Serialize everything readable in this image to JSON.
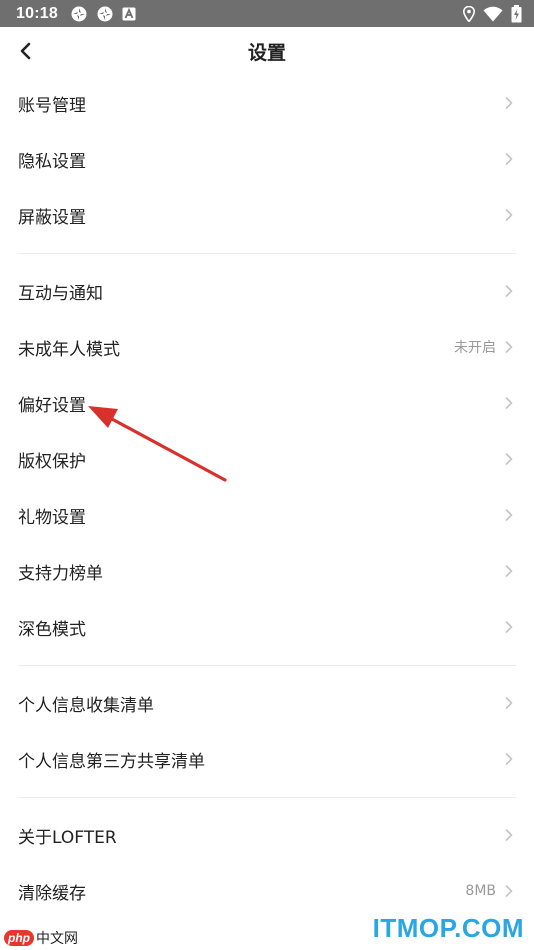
{
  "status_bar": {
    "time": "10:18",
    "left_icons": [
      "sync-icon",
      "sync-icon",
      "notification-a-icon"
    ],
    "right_icons": [
      "location-icon",
      "wifi-icon",
      "battery-charging-icon"
    ]
  },
  "nav": {
    "back_icon": "chevron-left-icon",
    "title": "设置"
  },
  "groups": [
    [
      {
        "label": "账号管理",
        "value": ""
      },
      {
        "label": "隐私设置",
        "value": ""
      },
      {
        "label": "屏蔽设置",
        "value": ""
      }
    ],
    [
      {
        "label": "互动与通知",
        "value": ""
      },
      {
        "label": "未成年人模式",
        "value": "未开启"
      },
      {
        "label": "偏好设置",
        "value": ""
      },
      {
        "label": "版权保护",
        "value": ""
      },
      {
        "label": "礼物设置",
        "value": ""
      },
      {
        "label": "支持力榜单",
        "value": ""
      },
      {
        "label": "深色模式",
        "value": ""
      }
    ],
    [
      {
        "label": "个人信息收集清单",
        "value": ""
      },
      {
        "label": "个人信息第三方共享清单",
        "value": ""
      }
    ],
    [
      {
        "label": "关于LOFTER",
        "value": ""
      },
      {
        "label": "清除缓存",
        "value": "8MB"
      }
    ]
  ],
  "watermarks": {
    "left_badge": "php",
    "left_text": "中文网",
    "right_text": "ITMOP.COM"
  },
  "colors": {
    "status_bar_bg": "#6f6f6f",
    "text_primary": "#222222",
    "text_secondary": "#9a9a9a",
    "chevron": "#c4c4c4",
    "annotation_arrow": "#d9302c",
    "watermark_blue": "#2aa7e2"
  }
}
